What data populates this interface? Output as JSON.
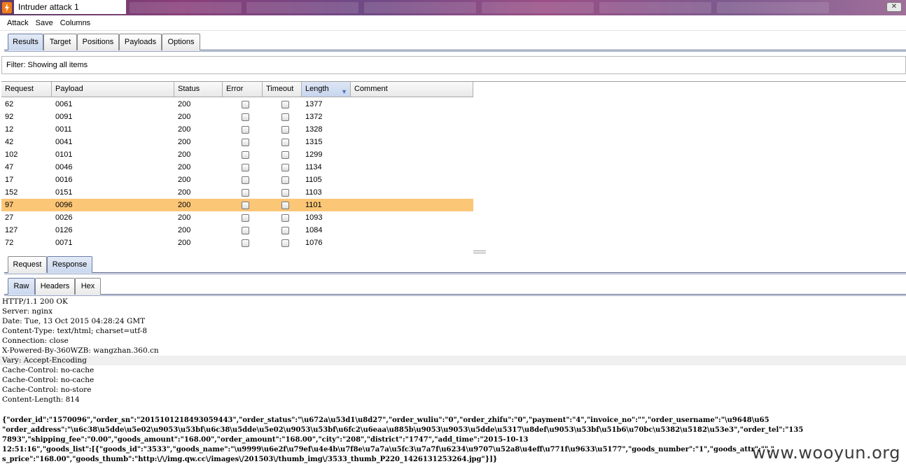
{
  "window": {
    "title": "Intruder attack 1",
    "close_label": "✕"
  },
  "menu": [
    "Attack",
    "Save",
    "Columns"
  ],
  "top_tabs": [
    "Results",
    "Target",
    "Positions",
    "Payloads",
    "Options"
  ],
  "filter_text": "Filter: Showing all items",
  "table": {
    "columns": [
      "Request",
      "Payload",
      "Status",
      "Error",
      "Timeout",
      "Length",
      "Comment"
    ],
    "sorted_column": "Length",
    "rows": [
      {
        "request": "62",
        "payload": "0061",
        "status": "200",
        "length": "1377"
      },
      {
        "request": "92",
        "payload": "0091",
        "status": "200",
        "length": "1372"
      },
      {
        "request": "12",
        "payload": "0011",
        "status": "200",
        "length": "1328"
      },
      {
        "request": "42",
        "payload": "0041",
        "status": "200",
        "length": "1315"
      },
      {
        "request": "102",
        "payload": "0101",
        "status": "200",
        "length": "1299"
      },
      {
        "request": "47",
        "payload": "0046",
        "status": "200",
        "length": "1134"
      },
      {
        "request": "17",
        "payload": "0016",
        "status": "200",
        "length": "1105"
      },
      {
        "request": "152",
        "payload": "0151",
        "status": "200",
        "length": "1103"
      },
      {
        "request": "97",
        "payload": "0096",
        "status": "200",
        "length": "1101",
        "selected": true
      },
      {
        "request": "27",
        "payload": "0026",
        "status": "200",
        "length": "1093"
      },
      {
        "request": "127",
        "payload": "0126",
        "status": "200",
        "length": "1084"
      },
      {
        "request": "72",
        "payload": "0071",
        "status": "200",
        "length": "1076"
      }
    ]
  },
  "msg_tabs": [
    "Request",
    "Response"
  ],
  "view_tabs": [
    "Raw",
    "Headers",
    "Hex"
  ],
  "response_lines": [
    "HTTP/1.1 200 OK",
    "Server: nginx",
    "Date: Tue, 13 Oct 2015 04:28:24 GMT",
    "Content-Type: text/html; charset=utf-8",
    "Connection: close",
    "X-Powered-By-360WZB: wangzhan.360.cn",
    "Vary: Accept-Encoding",
    "Cache-Control: no-cache",
    "Cache-Control: no-cache",
    "Cache-Control: no-store",
    "Content-Length: 814"
  ],
  "response_json_lines": [
    "{\"order_id\":\"1570096\",\"order_sn\":\"2015101218493059443\",\"order_status\":\"\\u672a\\u53d1\\u8d27\",\"order_wuliu\":\"0\",\"order_zhifu\":\"0\",\"payment\":\"4\",\"invoice_no\":\"\",\"order_username\":\"\\u9648\\u65",
    "\"order_address\":\"\\u6c38\\u5dde\\u5e02\\u9053\\u53bf\\u6c38\\u5dde\\u5e02\\u9053\\u53bf\\u6fc2\\u6eaa\\u885b\\u9053\\u9053\\u5dde\\u5317\\u8def\\u9053\\u53bf\\u51b6\\u70bc\\u5382\\u5182\\u53e3\",\"order_tel\":\"135",
    "7893\",\"shipping_fee\":\"0.00\",\"goods_amount\":\"168.00\",\"order_amount\":\"168.00\",\"city\":\"208\",\"district\":\"1747\",\"add_time\":\"2015-10-13",
    "12:51:16\",\"goods_list\":[{\"goods_id\":\"3533\",\"goods_name\":\"\\u9999\\u6e2f\\u79ef\\u4e4b\\u7f8e\\u7a7a\\u5fc3\\u7a7f\\u6234\\u9707\\u52a8\\u4eff\\u771f\\u9633\\u5177\",\"goods_number\":\"1\",\"goods_attr\":\"\",\"",
    "s_price\":\"168.00\",\"goods_thumb\":\"http:\\/\\/img.qw.cc\\/images\\/201503\\/thumb_img\\/3533_thumb_P220_1426131253264.jpg\"}]}"
  ],
  "watermark": "www.wooyun.org"
}
